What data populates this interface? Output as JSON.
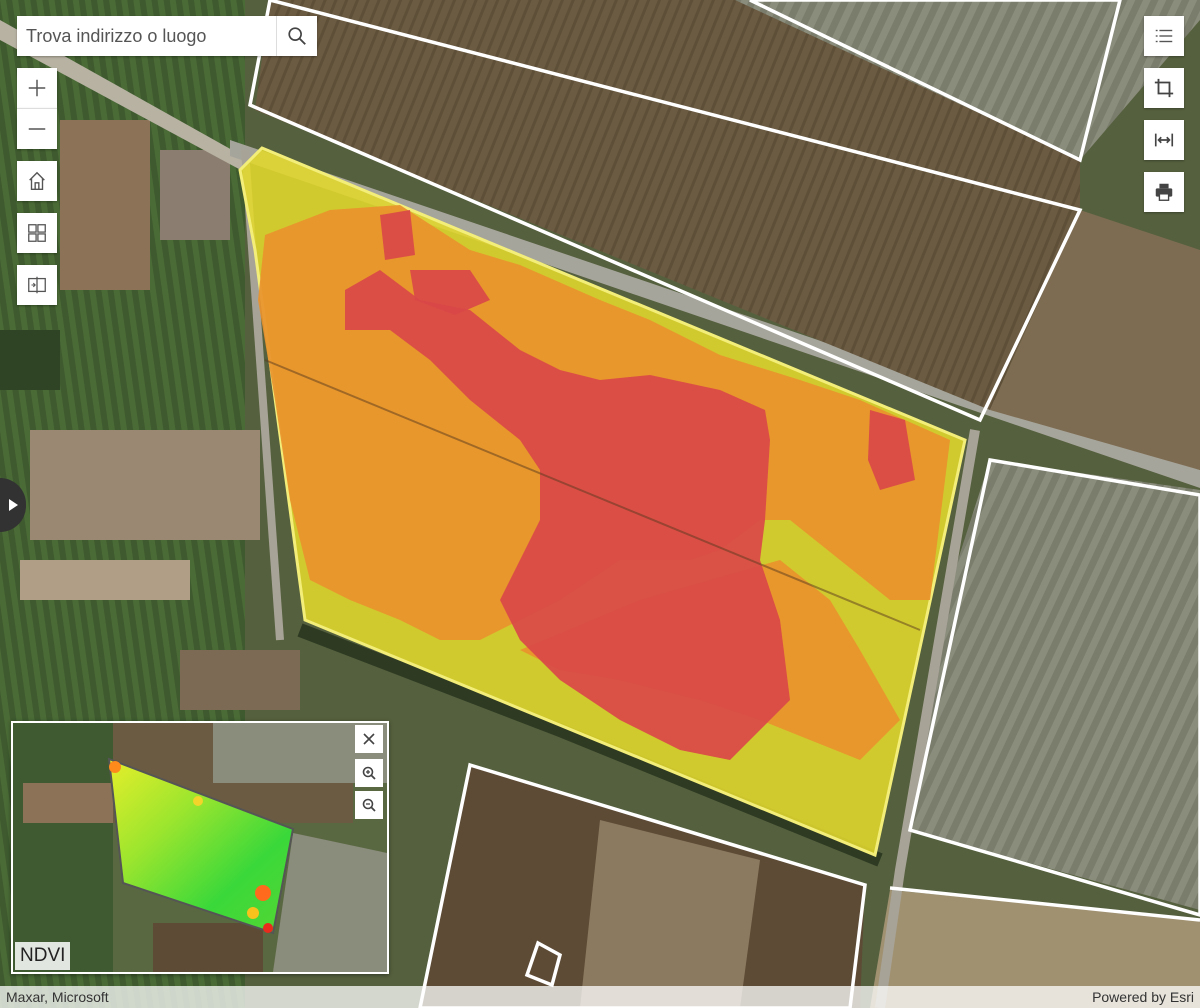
{
  "search": {
    "placeholder": "Trova indirizzo o luogo",
    "button": "search-icon"
  },
  "left_toolbar": [
    {
      "name": "zoom-in-button",
      "icon": "plus-icon"
    },
    {
      "name": "zoom-out-button",
      "icon": "minus-icon"
    },
    {
      "name": "home-button",
      "icon": "home-icon"
    },
    {
      "name": "basemap-gallery-button",
      "icon": "basemap-icon"
    },
    {
      "name": "swipe-button",
      "icon": "swipe-icon"
    }
  ],
  "right_toolbar": [
    {
      "name": "layer-list-button",
      "icon": "list-icon"
    },
    {
      "name": "crop-button",
      "icon": "crop-icon"
    },
    {
      "name": "measure-button",
      "icon": "measure-icon"
    },
    {
      "name": "print-button",
      "icon": "print-icon"
    }
  ],
  "overview": {
    "label": "NDVI"
  },
  "attribution": {
    "left": "Maxar, Microsoft",
    "right": "Powered by Esri"
  },
  "colors": {
    "red": "#d94848",
    "orange": "#e9922c",
    "yellow": "#e3d82c",
    "parcel_outline": "#ffffff"
  }
}
